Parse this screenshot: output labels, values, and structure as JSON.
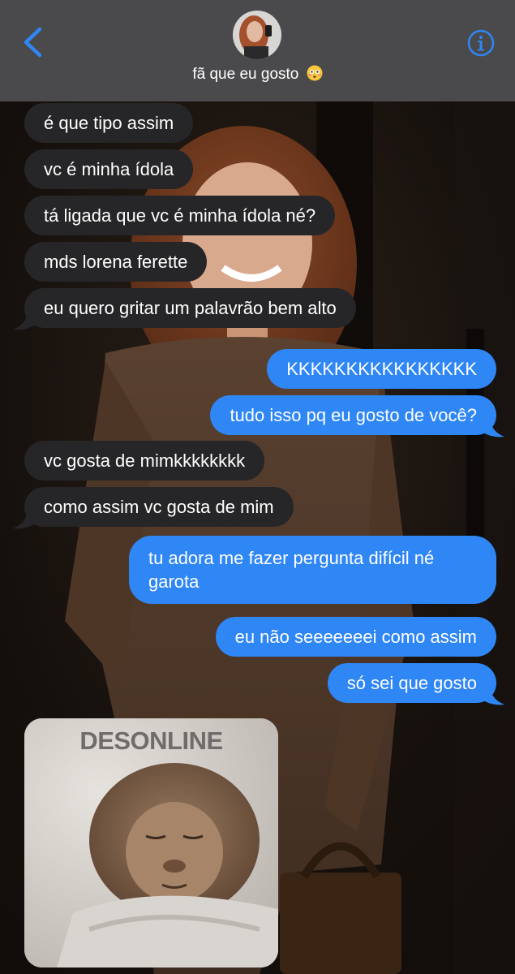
{
  "header": {
    "contact_name": "fã que eu gosto",
    "back_icon": "chevron-left-icon",
    "info_icon": "info-icon",
    "name_emoji": "flushed-face-emoji",
    "accent_color": "#2f86f5"
  },
  "messages": [
    {
      "from": "contact",
      "text": "é que tipo assim"
    },
    {
      "from": "contact",
      "text": "vc é minha ídola"
    },
    {
      "from": "contact",
      "text": "tá ligada que vc é minha ídola né?"
    },
    {
      "from": "contact",
      "text": "mds lorena ferette"
    },
    {
      "from": "contact",
      "text": "eu quero gritar um palavrão bem alto"
    },
    {
      "from": "me",
      "text": "KKKKKKKKKKKKKKKK"
    },
    {
      "from": "me",
      "text": "tudo isso pq eu gosto de você?"
    },
    {
      "from": "contact",
      "text": "vc gosta de mimkkkkkkkk"
    },
    {
      "from": "contact",
      "text": "como assim vc gosta de mim"
    },
    {
      "from": "me",
      "text": "tu adora me fazer pergunta difícil né garota"
    },
    {
      "from": "me",
      "text": "eu não seeeeeeei como assim"
    },
    {
      "from": "me",
      "text": "só sei que gosto"
    }
  ],
  "sticker": {
    "from": "contact",
    "caption": "DESONLINE",
    "subject": "sleeping-monkey-image"
  },
  "colors": {
    "header_bg": "#4a4a4c",
    "received_bubble": "#262628",
    "sent_bubble": "#2f86f5"
  }
}
